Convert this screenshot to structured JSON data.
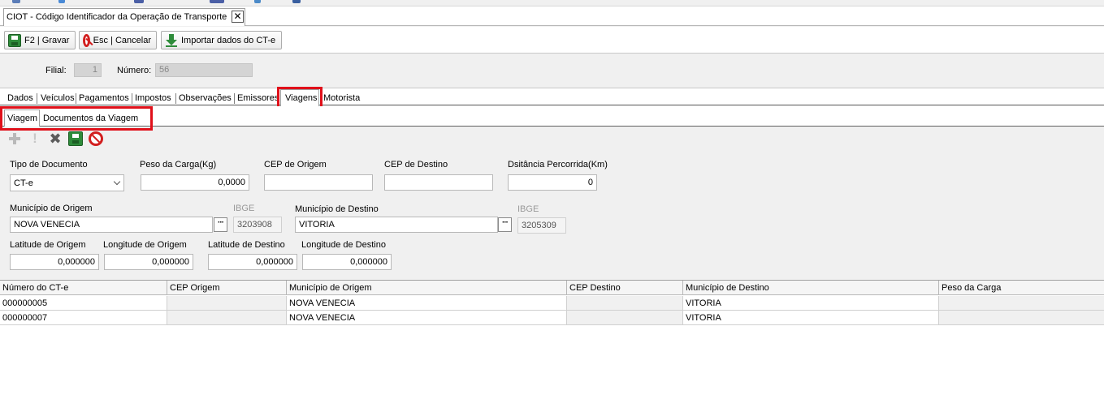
{
  "window_tab": {
    "title": "CIOT - Código Identificador da Operação de Transporte",
    "close_glyph": "✕"
  },
  "toolbar": {
    "save_label": "F2 | Gravar",
    "cancel_label": "Esc | Cancelar",
    "import_label": "Importar dados do CT-e"
  },
  "header": {
    "filial_label": "Filial:",
    "filial_value": "1",
    "numero_label": "Número:",
    "numero_value": "56"
  },
  "main_tabs": [
    "Dados",
    "Veículos",
    "Pagamentos",
    "Impostos",
    "Observações",
    "Emissores",
    "Viagens",
    "Motorista"
  ],
  "active_main_tab": "Viagens",
  "sub_tabs": [
    "Viagem",
    "Documentos da Viagem"
  ],
  "active_sub_tab": "Viagem",
  "form": {
    "tipo_documento_label": "Tipo de Documento",
    "tipo_documento_value": "CT-e",
    "peso_carga_label": "Peso da Carga(Kg)",
    "peso_carga_value": "0,0000",
    "cep_origem_label": "CEP de Origem",
    "cep_origem_value": "",
    "cep_destino_label": "CEP de Destino",
    "cep_destino_value": "",
    "distancia_label": "Dsitância Percorrida(Km)",
    "distancia_value": "0",
    "municipio_origem_label": "Município de Origem",
    "municipio_origem_value": "NOVA VENECIA",
    "ibge_origem_label": "IBGE",
    "ibge_origem_value": "3203908",
    "municipio_destino_label": "Município de Destino",
    "municipio_destino_value": "VITORIA",
    "ibge_destino_label": "IBGE",
    "ibge_destino_value": "3205309",
    "lookup_glyph": "···",
    "latitude_origem_label": "Latitude de Origem",
    "latitude_origem_value": "0,000000",
    "longitude_origem_label": "Longitude de Origem",
    "longitude_origem_value": "0,000000",
    "latitude_destino_label": "Latitude de Destino",
    "latitude_destino_value": "0,000000",
    "longitude_destino_label": "Longitude de Destino",
    "longitude_destino_value": "0,000000"
  },
  "icons": {
    "add": "plus-icon",
    "info": "exclamation-icon",
    "delete": "delete-x-icon",
    "save": "save-disk-icon",
    "cancel": "cancel-icon"
  },
  "grid": {
    "columns": [
      "Número do CT-e",
      "CEP Origem",
      "Município de Origem",
      "CEP Destino",
      "Município de Destino",
      "Peso da Carga"
    ],
    "rows": [
      [
        "000000005",
        "",
        "NOVA VENECIA",
        "",
        "VITORIA",
        ""
      ],
      [
        "000000007",
        "",
        "NOVA VENECIA",
        "",
        "VITORIA",
        ""
      ]
    ]
  },
  "colors": {
    "highlight": "#e0101a",
    "save_green": "#2e8b3a",
    "cancel_red": "#d21f1f"
  }
}
